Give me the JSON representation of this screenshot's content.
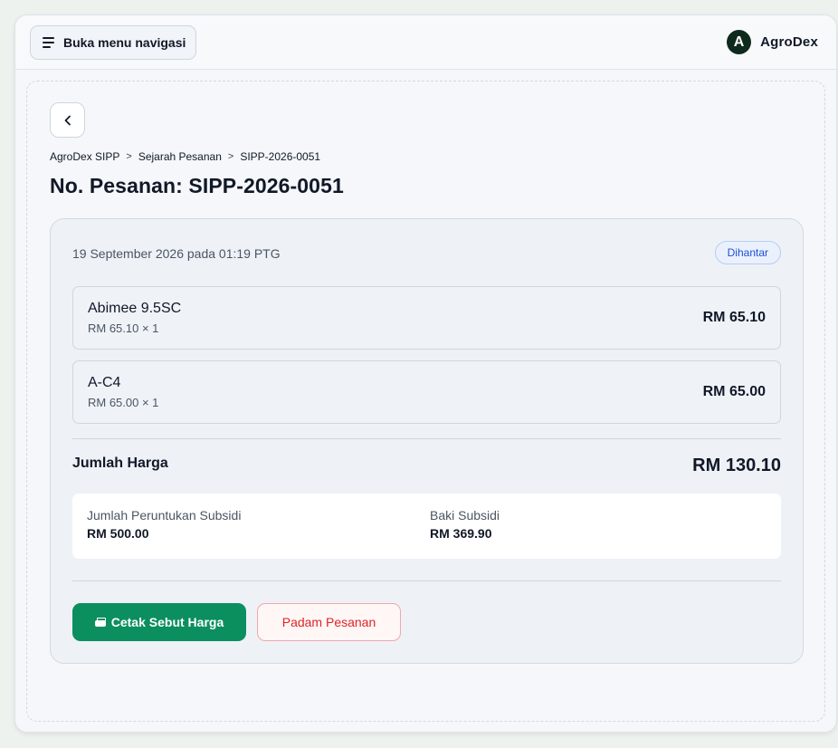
{
  "header": {
    "nav_button_label": "Buka menu navigasi",
    "brand_logo_letter": "A",
    "brand_name": "AgroDex"
  },
  "breadcrumb": [
    "AgroDex SIPP",
    "Sejarah Pesanan",
    "SIPP-2026-0051"
  ],
  "page_title": "No. Pesanan: SIPP-2026-0051",
  "order": {
    "date": "19 September 2026 pada 01:19 PTG",
    "status": "Dihantar",
    "items": [
      {
        "name": "Abimee 9.5SC",
        "qty_line": "RM 65.10 × 1",
        "total": "RM 65.10"
      },
      {
        "name": "A-C4",
        "qty_line": "RM 65.00 × 1",
        "total": "RM 65.00"
      }
    ],
    "total_label": "Jumlah Harga",
    "total_value": "RM 130.10",
    "subsidy": {
      "allocation_label": "Jumlah Peruntukan Subsidi",
      "allocation_value": "RM 500.00",
      "balance_label": "Baki Subsidi",
      "balance_value": "RM 369.90"
    }
  },
  "actions": {
    "print_label": "Cetak Sebut Harga",
    "delete_label": "Padam Pesanan"
  },
  "colors": {
    "primary_green": "#0b8f5e",
    "danger_red": "#dc2626",
    "status_blue": "#1d4ed8"
  }
}
